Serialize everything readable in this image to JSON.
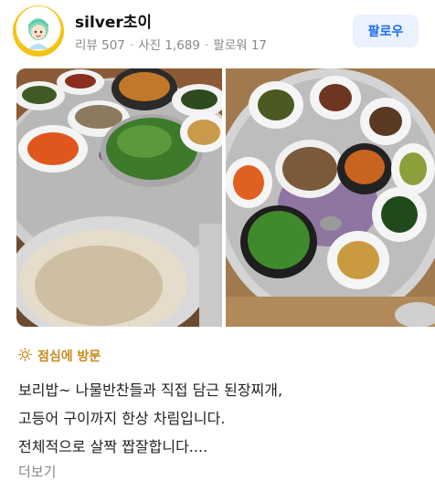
{
  "user": {
    "name": "silver초이",
    "stats": [
      "리뷰 507",
      "사진 1,689",
      "팔로워 17"
    ]
  },
  "actions": {
    "follow_label": "팔로우"
  },
  "visit": {
    "label": "점심에 방문"
  },
  "review": {
    "lines": [
      "보리밥~ 나물반찬들과 직접 담근 된장찌개,",
      "고등어 구이까지 한상 차림입니다.",
      "전체적으로 살짝 짭잘합니다...."
    ],
    "more_label": "더보기"
  },
  "colors": {
    "accent_blue": "#1a6bf0",
    "follow_bg": "#eaf2ff",
    "visit_gold": "#c98a1a",
    "badge_yellow": "#f5c518"
  },
  "icons": [
    "avatar-character-icon",
    "sun-icon"
  ]
}
